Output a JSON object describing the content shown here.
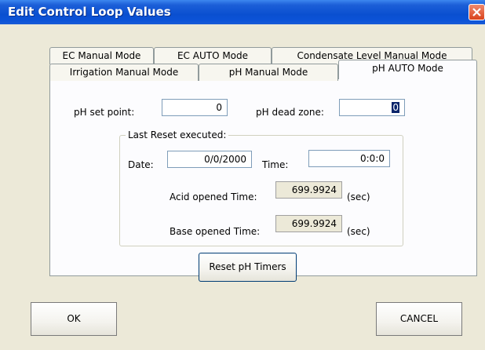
{
  "window": {
    "title": "Edit Control Loop Values",
    "close_icon": "close-icon"
  },
  "tabs": {
    "row1": [
      "EC Manual Mode",
      "EC AUTO Mode",
      "Condensate Level Manual Mode"
    ],
    "row2": [
      "Irrigation Manual Mode",
      "pH Manual Mode",
      "pH AUTO Mode"
    ],
    "active": "pH AUTO Mode"
  },
  "form": {
    "ph_set_point_label": "pH set point:",
    "ph_set_point_value": "0",
    "ph_dead_zone_label": "pH dead zone:",
    "ph_dead_zone_value": "0",
    "group_title": "Last Reset executed:",
    "date_label": "Date:",
    "date_value": "0/0/2000",
    "time_label": "Time:",
    "time_value": "0:0:0",
    "acid_label": "Acid opened Time:",
    "acid_value": "699.9924",
    "acid_unit": "(sec)",
    "base_label": "Base opened Time:",
    "base_value": "699.9924",
    "base_unit": "(sec)",
    "reset_button": "Reset pH Timers"
  },
  "footer": {
    "ok": "OK",
    "cancel": "CANCEL"
  }
}
